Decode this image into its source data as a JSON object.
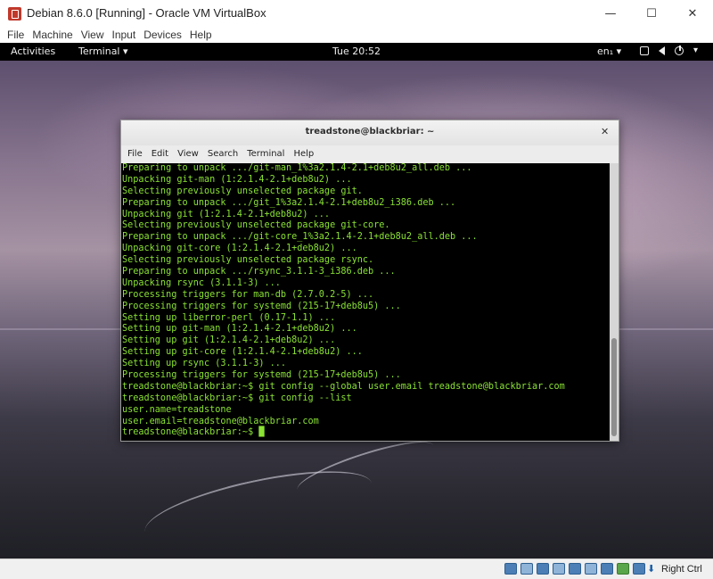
{
  "vbox": {
    "title": "Debian 8.6.0 [Running] - Oracle VM VirtualBox",
    "menu": [
      "File",
      "Machine",
      "View",
      "Input",
      "Devices",
      "Help"
    ],
    "controls": {
      "minimize": "—",
      "maximize": "☐",
      "close": "✕"
    },
    "status": {
      "host_key": "Right Ctrl"
    }
  },
  "gnome": {
    "activities": "Activities",
    "app_menu": "Terminal ▾",
    "clock": "Tue 20:52",
    "keyboard": "en₁ ▾",
    "tray_menu": "▾"
  },
  "terminal": {
    "title": "treadstone@blackbriar: ~",
    "close": "✕",
    "menu": [
      "File",
      "Edit",
      "View",
      "Search",
      "Terminal",
      "Help"
    ],
    "lines": [
      "Preparing to unpack .../git-man_1%3a2.1.4-2.1+deb8u2_all.deb ...",
      "Unpacking git-man (1:2.1.4-2.1+deb8u2) ...",
      "Selecting previously unselected package git.",
      "Preparing to unpack .../git_1%3a2.1.4-2.1+deb8u2_i386.deb ...",
      "Unpacking git (1:2.1.4-2.1+deb8u2) ...",
      "Selecting previously unselected package git-core.",
      "Preparing to unpack .../git-core_1%3a2.1.4-2.1+deb8u2_all.deb ...",
      "Unpacking git-core (1:2.1.4-2.1+deb8u2) ...",
      "Selecting previously unselected package rsync.",
      "Preparing to unpack .../rsync_3.1.1-3_i386.deb ...",
      "Unpacking rsync (3.1.1-3) ...",
      "Processing triggers for man-db (2.7.0.2-5) ...",
      "Processing triggers for systemd (215-17+deb8u5) ...",
      "Setting up liberror-perl (0.17-1.1) ...",
      "Setting up git-man (1:2.1.4-2.1+deb8u2) ...",
      "Setting up git (1:2.1.4-2.1+deb8u2) ...",
      "Setting up git-core (1:2.1.4-2.1+deb8u2) ...",
      "Setting up rsync (3.1.1-3) ...",
      "Processing triggers for systemd (215-17+deb8u5) ...",
      "treadstone@blackbriar:~$ git config --global user.email treadstone@blackbriar.com",
      "treadstone@blackbriar:~$ git config --list",
      "user.name=treadstone",
      "user.email=treadstone@blackbriar.com",
      "treadstone@blackbriar:~$ "
    ],
    "cursor": "█"
  },
  "colors": {
    "terminal_fg": "#8ae234",
    "terminal_bg": "#000000",
    "topbar_bg": "#000000"
  }
}
